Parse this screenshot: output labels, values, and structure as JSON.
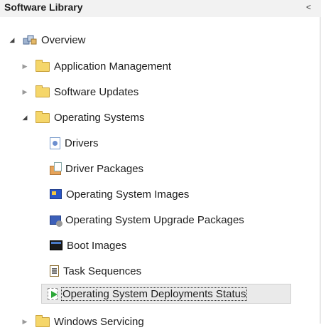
{
  "header": {
    "title": "Software Library",
    "collapse_glyph": "<"
  },
  "tree": {
    "overview": {
      "label": "Overview",
      "icon": "overview-icon"
    },
    "items": [
      {
        "label": "Application Management",
        "icon": "folder-icon",
        "expanded": false
      },
      {
        "label": "Software Updates",
        "icon": "folder-icon",
        "expanded": false
      },
      {
        "label": "Operating Systems",
        "icon": "folder-icon",
        "expanded": true
      },
      {
        "label": "Drivers",
        "icon": "drivers-icon"
      },
      {
        "label": "Driver Packages",
        "icon": "driver-package-icon"
      },
      {
        "label": "Operating System Images",
        "icon": "os-image-icon"
      },
      {
        "label": "Operating System Upgrade Packages",
        "icon": "os-upgrade-icon"
      },
      {
        "label": "Boot Images",
        "icon": "boot-image-icon"
      },
      {
        "label": "Task Sequences",
        "icon": "task-sequence-icon"
      },
      {
        "label": "Operating System Deployments Status",
        "icon": "deployment-status-icon",
        "selected": true
      },
      {
        "label": "Windows Servicing",
        "icon": "folder-icon",
        "expanded": false
      }
    ]
  }
}
